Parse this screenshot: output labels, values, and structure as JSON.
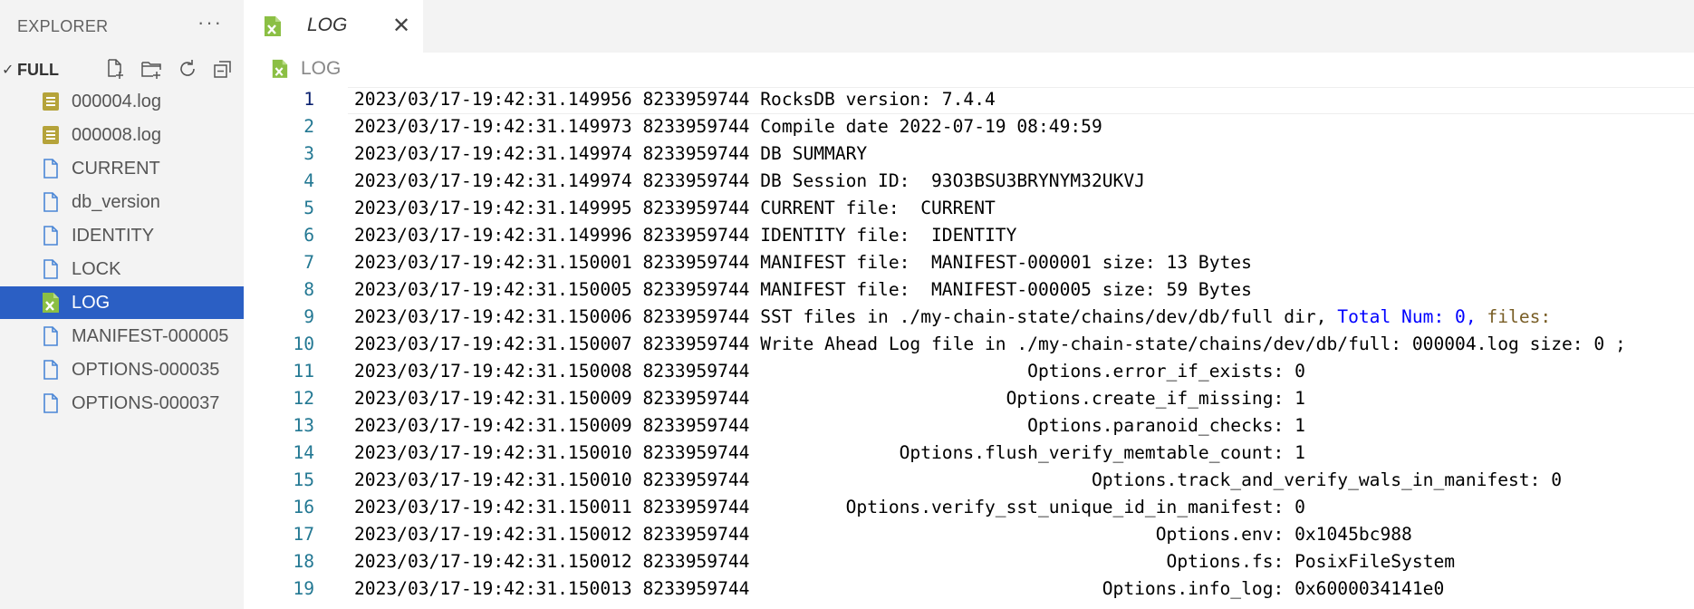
{
  "sidebar": {
    "title": "EXPLORER",
    "more": "···",
    "folder": {
      "chevron": "✓",
      "name": "FULL"
    },
    "toolbar_icons": [
      "new-file-icon",
      "new-folder-icon",
      "refresh-icon",
      "collapse-all-icon"
    ],
    "files": [
      {
        "name": "000004.log",
        "icon": "log-file-icon"
      },
      {
        "name": "000008.log",
        "icon": "log-file-icon"
      },
      {
        "name": "CURRENT",
        "icon": "file-icon"
      },
      {
        "name": "db_version",
        "icon": "file-icon"
      },
      {
        "name": "IDENTITY",
        "icon": "file-icon"
      },
      {
        "name": "LOCK",
        "icon": "file-icon"
      },
      {
        "name": "LOG",
        "icon": "spreadsheet-file-icon",
        "selected": true
      },
      {
        "name": "MANIFEST-000005",
        "icon": "file-icon"
      },
      {
        "name": "OPTIONS-000035",
        "icon": "file-icon"
      },
      {
        "name": "OPTIONS-000037",
        "icon": "file-icon"
      }
    ]
  },
  "tab": {
    "label": "LOG",
    "close": "✕"
  },
  "breadcrumb": {
    "label": "LOG"
  },
  "colors": {
    "selection": "#2b5fc4",
    "line_number": "#237893",
    "keyword": "#0000ff",
    "function": "#795e26"
  },
  "editor": {
    "lines": [
      {
        "n": "1",
        "pre": "2023/03/17-19:42:31.149956 8233959744 RocksDB version: 7.4.4",
        "kw": "",
        "fl": ""
      },
      {
        "n": "2",
        "pre": "2023/03/17-19:42:31.149973 8233959744 Compile date 2022-07-19 08:49:59",
        "kw": "",
        "fl": ""
      },
      {
        "n": "3",
        "pre": "2023/03/17-19:42:31.149974 8233959744 DB SUMMARY",
        "kw": "",
        "fl": ""
      },
      {
        "n": "4",
        "pre": "2023/03/17-19:42:31.149974 8233959744 DB Session ID:  93O3BSU3BRYNYM32UKVJ",
        "kw": "",
        "fl": ""
      },
      {
        "n": "5",
        "pre": "2023/03/17-19:42:31.149995 8233959744 CURRENT file:  CURRENT",
        "kw": "",
        "fl": ""
      },
      {
        "n": "6",
        "pre": "2023/03/17-19:42:31.149996 8233959744 IDENTITY file:  IDENTITY",
        "kw": "",
        "fl": ""
      },
      {
        "n": "7",
        "pre": "2023/03/17-19:42:31.150001 8233959744 MANIFEST file:  MANIFEST-000001 size: 13 Bytes",
        "kw": "",
        "fl": ""
      },
      {
        "n": "8",
        "pre": "2023/03/17-19:42:31.150005 8233959744 MANIFEST file:  MANIFEST-000005 size: 59 Bytes",
        "kw": "",
        "fl": ""
      },
      {
        "n": "9",
        "pre": "2023/03/17-19:42:31.150006 8233959744 SST files in ./my-chain-state/chains/dev/db/full dir, ",
        "kw": "Total Num: 0,",
        "fl": " files:"
      },
      {
        "n": "10",
        "pre": "2023/03/17-19:42:31.150007 8233959744 Write Ahead Log file in ./my-chain-state/chains/dev/db/full: 000004.log size: 0 ;",
        "kw": "",
        "fl": ""
      },
      {
        "n": "11",
        "pre": "2023/03/17-19:42:31.150008 8233959744                          Options.error_if_exists: 0",
        "kw": "",
        "fl": ""
      },
      {
        "n": "12",
        "pre": "2023/03/17-19:42:31.150009 8233959744                        Options.create_if_missing: 1",
        "kw": "",
        "fl": ""
      },
      {
        "n": "13",
        "pre": "2023/03/17-19:42:31.150009 8233959744                          Options.paranoid_checks: 1",
        "kw": "",
        "fl": ""
      },
      {
        "n": "14",
        "pre": "2023/03/17-19:42:31.150010 8233959744              Options.flush_verify_memtable_count: 1",
        "kw": "",
        "fl": ""
      },
      {
        "n": "15",
        "pre": "2023/03/17-19:42:31.150010 8233959744                                Options.track_and_verify_wals_in_manifest: 0",
        "kw": "",
        "fl": ""
      },
      {
        "n": "16",
        "pre": "2023/03/17-19:42:31.150011 8233959744         Options.verify_sst_unique_id_in_manifest: 0",
        "kw": "",
        "fl": ""
      },
      {
        "n": "17",
        "pre": "2023/03/17-19:42:31.150012 8233959744                                      Options.env: 0x1045bc988",
        "kw": "",
        "fl": ""
      },
      {
        "n": "18",
        "pre": "2023/03/17-19:42:31.150012 8233959744                                       Options.fs: PosixFileSystem",
        "kw": "",
        "fl": ""
      },
      {
        "n": "19",
        "pre": "2023/03/17-19:42:31.150013 8233959744                                 Options.info_log: 0x6000034141e0",
        "kw": "",
        "fl": ""
      }
    ]
  }
}
